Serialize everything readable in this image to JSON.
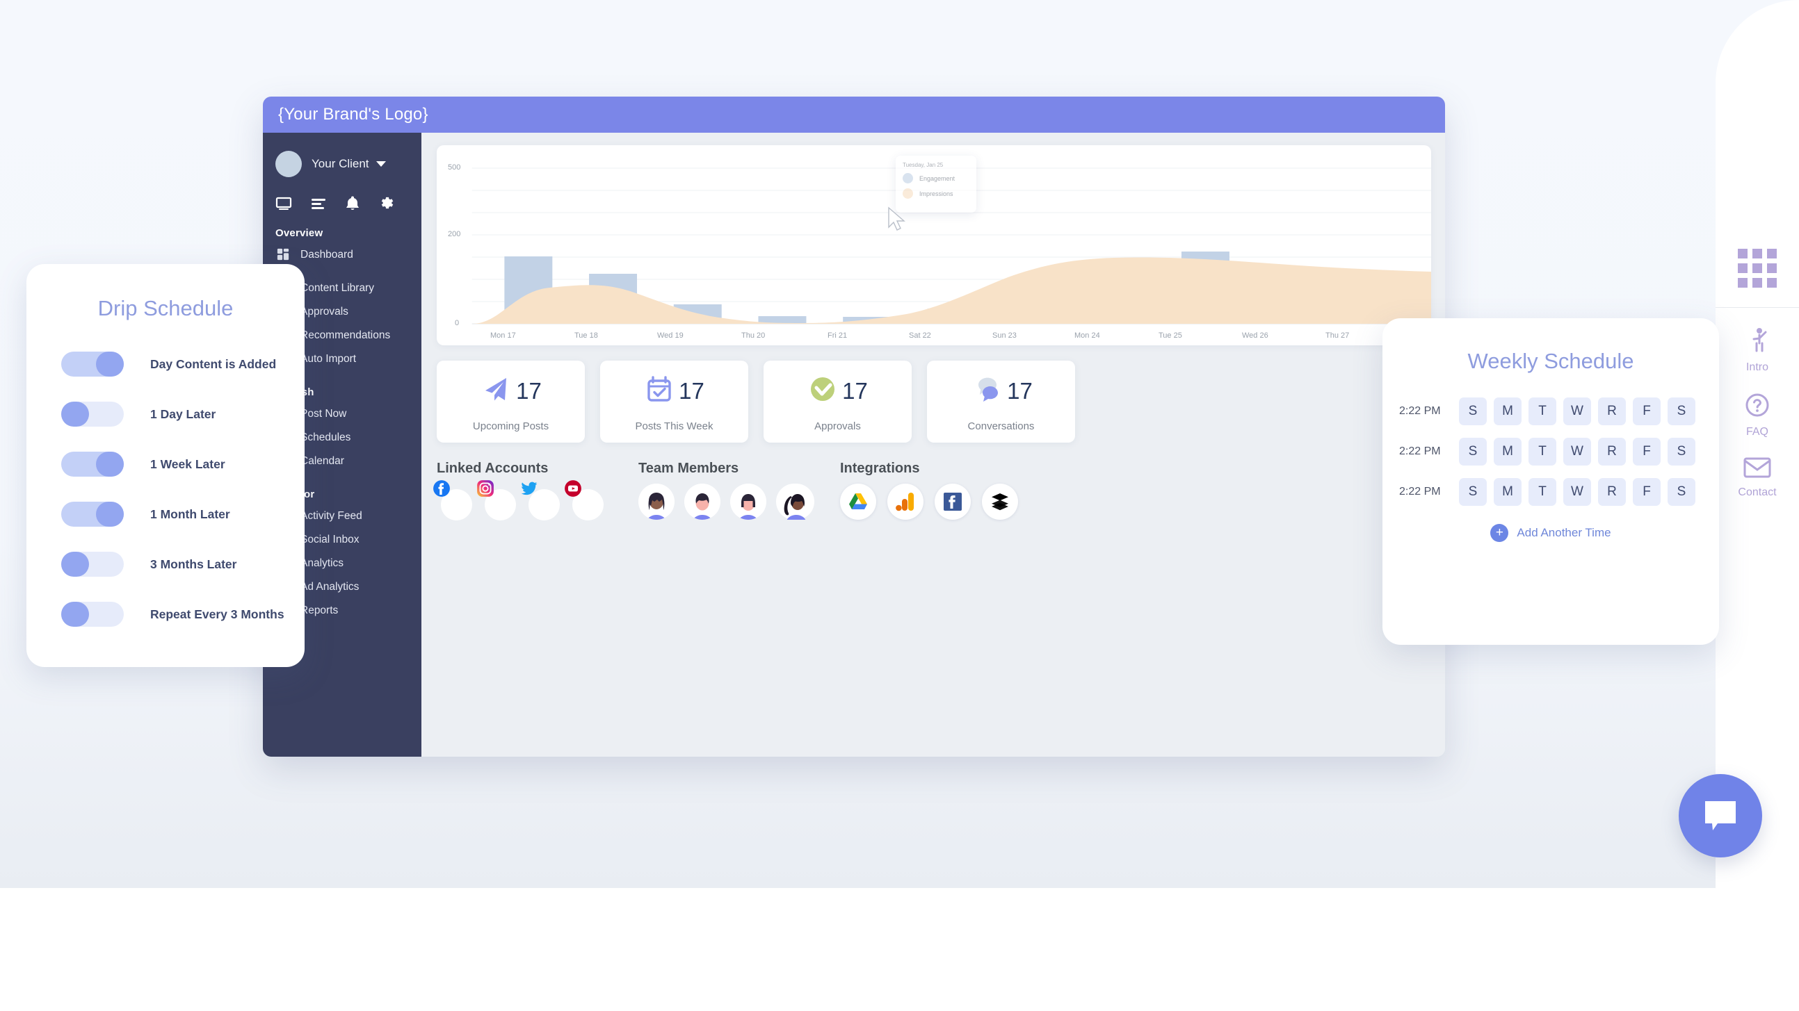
{
  "app": {
    "brand_title": "{Your Brand's Logo}",
    "header_color": "#7b86e8"
  },
  "sidebar": {
    "client_name": "Your Client",
    "caret_icon": "chevron-down-icon",
    "quick_icons": [
      "monitor-icon",
      "list-icon",
      "bell-icon",
      "gear-icon"
    ],
    "sections": [
      {
        "title": "Overview",
        "items": [
          {
            "label": "Dashboard",
            "icon": "dashboard-icon"
          }
        ]
      },
      {
        "title": "",
        "items": [
          {
            "label": "Content Library",
            "icon": "library-icon"
          },
          {
            "label": "Approvals",
            "icon": "check-icon"
          },
          {
            "label": "Recommendations",
            "icon": "star-icon"
          },
          {
            "label": "Auto Import",
            "icon": "import-icon"
          }
        ]
      },
      {
        "title": "Publish",
        "items": [
          {
            "label": "Post Now",
            "icon": "send-icon"
          },
          {
            "label": "Schedules",
            "icon": "clock-icon"
          },
          {
            "label": "Calendar",
            "icon": "calendar-icon"
          }
        ]
      },
      {
        "title": "Monitor",
        "items": [
          {
            "label": "Activity Feed",
            "icon": "feed-icon"
          },
          {
            "label": "Social Inbox",
            "icon": "inbox-icon"
          },
          {
            "label": "Analytics",
            "icon": "analytics-icon"
          },
          {
            "label": "Ad Analytics",
            "icon": "ad-analytics-icon"
          },
          {
            "label": "Reports",
            "icon": "reports-icon"
          }
        ]
      }
    ]
  },
  "chart_data": {
    "type": "bar",
    "title": "",
    "xlabel": "",
    "ylabel": "",
    "grid": true,
    "ylim": [
      0,
      500
    ],
    "ytick_labels": [
      "0",
      "200",
      "500"
    ],
    "ytick_values": [
      0,
      200,
      500
    ],
    "categories": [
      "Mon 17",
      "Tue 18",
      "Wed 19",
      "Thu 20",
      "Fri 21",
      "Sat 22",
      "Sun 23",
      "Mon 24",
      "Tue 25",
      "Wed 26",
      "Thu 27"
    ],
    "series": [
      {
        "name": "Engagement",
        "type": "bar",
        "color": "#c2d2e6",
        "values": [
          200,
          150,
          58,
          22,
          20,
          45,
          130,
          170,
          215,
          0,
          150
        ]
      },
      {
        "name": "Impressions",
        "type": "area",
        "color": "#f7e0c4",
        "values": [
          8,
          105,
          120,
          72,
          26,
          14,
          22,
          80,
          160,
          185,
          178
        ]
      }
    ],
    "tooltip": {
      "date": "Tuesday, Jan 25",
      "rows": [
        {
          "label": "Engagement",
          "color": "#c2d2e6"
        },
        {
          "label": "Impressions",
          "color": "#f7e0c4"
        }
      ]
    }
  },
  "stats": [
    {
      "label": "Upcoming Posts",
      "value": "17",
      "icon": "paper-plane-icon",
      "color": "#8a96ee"
    },
    {
      "label": "Posts This Week",
      "value": "17",
      "icon": "calendar-check-icon",
      "color": "#8a96ee"
    },
    {
      "label": "Approvals",
      "value": "17",
      "icon": "check-circle-icon",
      "color": "#bdd07a"
    },
    {
      "label": "Conversations",
      "value": "17",
      "icon": "chat-bubbles-icon",
      "color": "#8a96ee"
    }
  ],
  "linked_accounts": {
    "title": "Linked Accounts",
    "items": [
      {
        "name": "facebook-icon",
        "color": "#1877f2"
      },
      {
        "name": "instagram-icon",
        "color": "#e1306c"
      },
      {
        "name": "twitter-icon",
        "color": "#1da1f2"
      },
      {
        "name": "youtube-icon",
        "color": "#c4002b"
      }
    ]
  },
  "team_members": {
    "title": "Team Members",
    "count": 4
  },
  "integrations": {
    "title": "Integrations",
    "items": [
      {
        "name": "google-drive-icon"
      },
      {
        "name": "google-analytics-icon"
      },
      {
        "name": "facebook-icon"
      },
      {
        "name": "buffer-icon"
      }
    ]
  },
  "drip_schedule": {
    "title": "Drip Schedule",
    "items": [
      {
        "label": "Day Content is  Added",
        "on": true
      },
      {
        "label": "1 Day Later",
        "on": false
      },
      {
        "label": "1 Week Later",
        "on": true
      },
      {
        "label": "1 Month Later",
        "on": true
      },
      {
        "label": "3 Months Later",
        "on": false
      },
      {
        "label": "Repeat Every 3 Months",
        "on": false
      }
    ]
  },
  "weekly_schedule": {
    "title": "Weekly Schedule",
    "day_labels": [
      "S",
      "M",
      "T",
      "W",
      "R",
      "F",
      "S"
    ],
    "rows": [
      {
        "time": "2:22 PM"
      },
      {
        "time": "2:22 PM"
      },
      {
        "time": "2:22 PM"
      }
    ],
    "add_label": "Add Another Time",
    "add_icon": "plus-icon"
  },
  "right_rail": {
    "grid_icon": "apps-grid-icon",
    "items": [
      {
        "label": "Intro",
        "icon": "person-wave-icon"
      },
      {
        "label": "FAQ",
        "icon": "question-circle-icon"
      },
      {
        "label": "Contact",
        "icon": "envelope-icon"
      }
    ]
  },
  "chat_fab": {
    "icon": "chat-icon",
    "color": "#7083e8"
  }
}
